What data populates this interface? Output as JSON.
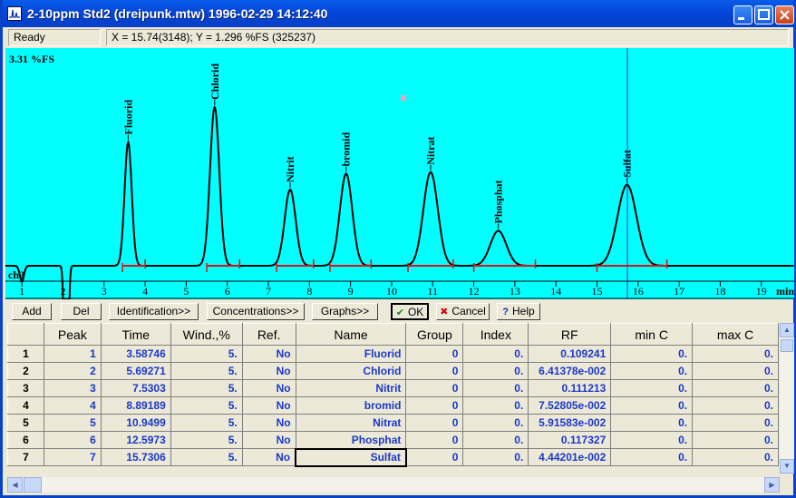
{
  "window": {
    "title": "2-10ppm Std2 (dreipunk.mtw) 1996-02-29 14:12:40"
  },
  "status": {
    "state": "Ready",
    "cursor": "X = 15.74(3148); Y = 1.296 %FS (325237)"
  },
  "chart_data": {
    "type": "line",
    "y_max_label": "3.31 %FS",
    "channel_label": "ch2",
    "x_unit": "min",
    "xlim": [
      0.6,
      19.8
    ],
    "x_ticks": [
      1,
      2,
      3,
      4,
      5,
      6,
      7,
      8,
      9,
      10,
      11,
      12,
      13,
      14,
      15,
      16,
      17,
      18,
      19
    ],
    "cursor_x": 15.74,
    "peaks": [
      {
        "name": "Fluorid",
        "time": 3.58746,
        "height": 0.78,
        "start": 3.45,
        "end": 4.0
      },
      {
        "name": "Chlorid",
        "time": 5.69271,
        "height": 1.0,
        "start": 5.5,
        "end": 6.3
      },
      {
        "name": "Nitrit",
        "time": 7.5303,
        "height": 0.48,
        "start": 7.2,
        "end": 8.1
      },
      {
        "name": "bromid",
        "time": 8.89189,
        "height": 0.58,
        "start": 8.5,
        "end": 9.5
      },
      {
        "name": "Nitrat",
        "time": 10.9499,
        "height": 0.59,
        "start": 10.4,
        "end": 11.5
      },
      {
        "name": "Phosphat",
        "time": 12.5973,
        "height": 0.22,
        "start": 12.0,
        "end": 13.5
      },
      {
        "name": "Sulfat",
        "time": 15.7306,
        "height": 0.51,
        "start": 15.0,
        "end": 16.7
      }
    ]
  },
  "toolbar": {
    "add": "Add",
    "del": "Del",
    "identification": "Identification>>",
    "concentrations": "Concentrations>>",
    "graphs": "Graphs>>",
    "ok": "OK",
    "cancel": "Cancel",
    "help": "Help"
  },
  "table": {
    "headers": [
      "Peak",
      "Time",
      "Wind.,%",
      "Ref.",
      "Name",
      "Group",
      "Index",
      "RF",
      "min C",
      "max C"
    ],
    "rows": [
      {
        "n": "1",
        "peak": "1",
        "time": "3.58746",
        "wind": "5.",
        "ref": "No",
        "name": "Fluorid",
        "group": "0",
        "index": "0.",
        "rf": "0.109241",
        "minc": "0.",
        "maxc": "0."
      },
      {
        "n": "2",
        "peak": "2",
        "time": "5.69271",
        "wind": "5.",
        "ref": "No",
        "name": "Chlorid",
        "group": "0",
        "index": "0.",
        "rf": "6.41378e-002",
        "minc": "0.",
        "maxc": "0."
      },
      {
        "n": "3",
        "peak": "3",
        "time": "7.5303",
        "wind": "5.",
        "ref": "No",
        "name": "Nitrit",
        "group": "0",
        "index": "0.",
        "rf": "0.111213",
        "minc": "0.",
        "maxc": "0."
      },
      {
        "n": "4",
        "peak": "4",
        "time": "8.89189",
        "wind": "5.",
        "ref": "No",
        "name": "bromid",
        "group": "0",
        "index": "0.",
        "rf": "7.52805e-002",
        "minc": "0.",
        "maxc": "0."
      },
      {
        "n": "5",
        "peak": "5",
        "time": "10.9499",
        "wind": "5.",
        "ref": "No",
        "name": "Nitrat",
        "group": "0",
        "index": "0.",
        "rf": "5.91583e-002",
        "minc": "0.",
        "maxc": "0."
      },
      {
        "n": "6",
        "peak": "6",
        "time": "12.5973",
        "wind": "5.",
        "ref": "No",
        "name": "Phosphat",
        "group": "0",
        "index": "0.",
        "rf": "0.117327",
        "minc": "0.",
        "maxc": "0."
      },
      {
        "n": "7",
        "peak": "7",
        "time": "15.7306",
        "wind": "5.",
        "ref": "No",
        "name": "Sulfat",
        "group": "0",
        "index": "0.",
        "rf": "4.44201e-002",
        "minc": "0.",
        "maxc": "0."
      }
    ]
  }
}
